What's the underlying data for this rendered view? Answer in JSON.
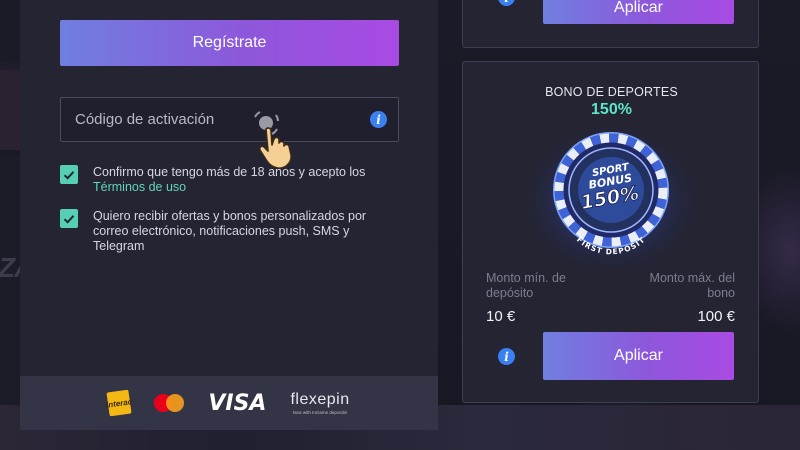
{
  "registration": {
    "register_label": "Regístrate",
    "code_placeholder": "Código de activación",
    "consent_text": "Confirmo que tengo más de 18 años y acepto los",
    "terms_link": "Términos de uso",
    "offers_text": "Quiero recibir ofertas y bonos personalizados por correo electrónico, notificaciones push, SMS y Telegram"
  },
  "payments": {
    "interac_label": "Interac",
    "visa_label": "VISA",
    "flexepin_name": "flexepin",
    "flexepin_tagline": "Now with InGame deposits!",
    "icons": [
      "interac-icon",
      "mastercard-icon",
      "visa-icon",
      "flexepin-icon"
    ]
  },
  "bonus_cards": [
    {
      "apply_label": "Aplicar"
    },
    {
      "title": "BONO DE DEPORTES",
      "percent": "150%",
      "chip": {
        "line1": "SPORT",
        "line2": "BONUS",
        "line3": "150%",
        "ring_text": "FIRST DEPOSIT"
      },
      "min_label": "Monto mín. de depósito",
      "max_label": "Monto máx. del bono",
      "min_value": "10 €",
      "max_value": "100 €",
      "apply_label": "Aplicar"
    }
  ],
  "info_icon_glyph": "i",
  "colors": {
    "accent_gradient": [
      "#6f7fe0",
      "#a94ae4"
    ],
    "checkbox": "#57cfb6",
    "link": "#5fd6bd",
    "percent": "#5fe3c6",
    "info": "#3b80f0"
  }
}
